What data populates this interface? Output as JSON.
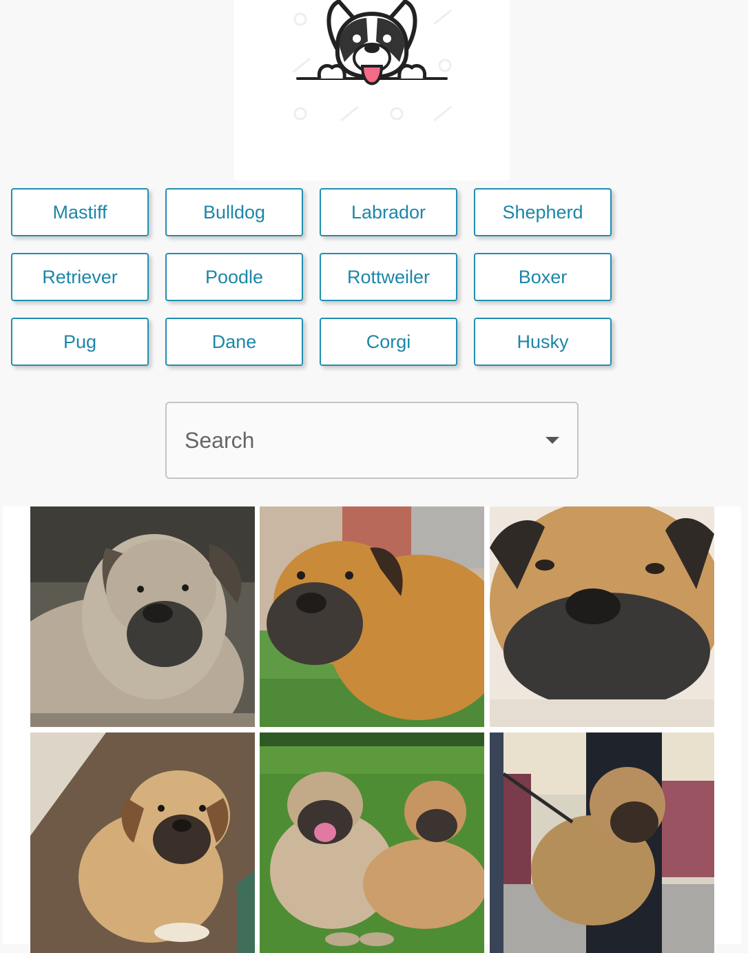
{
  "header": {
    "logo_icon": "peeking-bulldog-logo"
  },
  "breeds": [
    {
      "label": "Mastiff"
    },
    {
      "label": "Bulldog"
    },
    {
      "label": "Labrador"
    },
    {
      "label": "Shepherd"
    },
    {
      "label": "Retriever"
    },
    {
      "label": "Poodle"
    },
    {
      "label": "Rottweiler"
    },
    {
      "label": "Boxer"
    },
    {
      "label": "Pug"
    },
    {
      "label": "Dane"
    },
    {
      "label": "Corgi"
    },
    {
      "label": "Husky"
    }
  ],
  "search": {
    "placeholder": "Search",
    "icon": "caret-down-icon"
  },
  "colors": {
    "accent": "#1f8fb0",
    "page_background": "#f8f8f8"
  }
}
